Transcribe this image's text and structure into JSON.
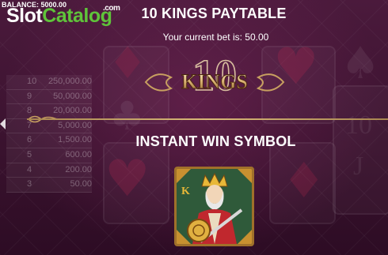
{
  "header": {
    "balance_label": "BALANCE: 5000.00",
    "logo_slot": "Slot",
    "logo_catalog": "Catalog",
    "logo_com": ".com"
  },
  "paytable": {
    "title": "10 KINGS PAYTABLE",
    "bet_text": "Your current bet is: 50.00",
    "game_logo_text": "KINGS",
    "game_logo_number": "10",
    "section_title": "INSTANT WIN SYMBOL",
    "symbol_icon": "king-card-icon"
  },
  "bg_table": {
    "rows": [
      {
        "count": "10",
        "value": "250,000.00"
      },
      {
        "count": "9",
        "value": "50,000.00"
      },
      {
        "count": "8",
        "value": "20,000.00"
      },
      {
        "count": "7",
        "value": "5,000.00"
      },
      {
        "count": "6",
        "value": "1,500.00"
      },
      {
        "count": "5",
        "value": "600.00"
      },
      {
        "count": "4",
        "value": "200.00"
      },
      {
        "count": "3",
        "value": "50.00"
      }
    ]
  },
  "colors": {
    "background": "#3a1430",
    "gold": "#c8a060",
    "logo_green": "#5fc43a"
  }
}
